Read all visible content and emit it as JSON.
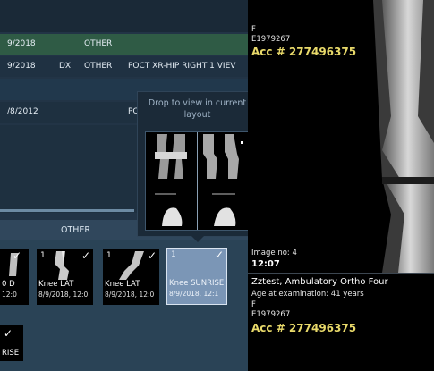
{
  "study_list": {
    "rows": [
      {
        "date": "9/2018",
        "modality": "",
        "type": "OTHER",
        "description": ""
      },
      {
        "date": "9/2018",
        "modality": "DX",
        "type": "OTHER",
        "description": "POCT XR-HIP RIGHT 1 VIEV"
      },
      {
        "date": "",
        "modality": "",
        "type": "",
        "description": ""
      },
      {
        "date": "/8/2012",
        "modality": "",
        "type": "",
        "description": "PC"
      }
    ]
  },
  "series_panel": {
    "group_label": "OTHER",
    "thumbnails": [
      {
        "number": "",
        "checked": "✓",
        "label": "0 D",
        "date": "12:0"
      },
      {
        "number": "1",
        "checked": "✓",
        "label": "Knee LAT",
        "date": "8/9/2018, 12:0"
      },
      {
        "number": "1",
        "checked": "✓",
        "label": "Knee LAT",
        "date": "8/9/2018, 12:0"
      },
      {
        "number": "1",
        "checked": "✓",
        "label": "Knee SUNRISE",
        "date": "8/9/2018, 12:1"
      },
      {
        "number": "",
        "checked": "✓",
        "label": "RISE",
        "date": ""
      }
    ]
  },
  "drop_popup": {
    "text": "Drop to view in current layout"
  },
  "viewer_top": {
    "sex": "F",
    "patient_id": "E1979267",
    "accession": "Acc # 277496375",
    "image_no": "Image no: 4",
    "time": "12:07"
  },
  "viewer_bottom": {
    "patient_name": "Zztest, Ambulatory Ortho Four",
    "age": "Age at examination: 41 years",
    "sex": "F",
    "patient_id": "E1979267",
    "accession": "Acc # 277496375"
  },
  "colors": {
    "accession": "#e8d96a",
    "selected_row": "#2f5b45",
    "panel_bg": "#223446",
    "selected_thumb": "#7b96b6"
  }
}
